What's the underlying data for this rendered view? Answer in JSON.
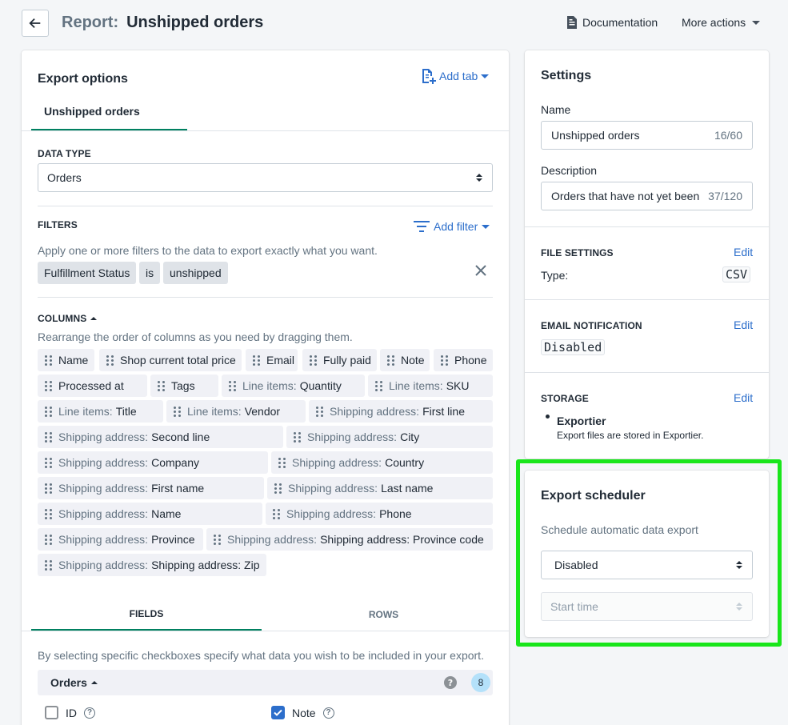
{
  "header": {
    "title_prefix": "Report:",
    "title": "Unshipped orders",
    "documentation_label": "Documentation",
    "more_actions_label": "More actions"
  },
  "export_options": {
    "title": "Export options",
    "add_tab_label": "Add tab",
    "active_tab": "Unshipped orders",
    "data_type": {
      "label": "DATA TYPE",
      "value": "Orders"
    },
    "filters": {
      "label": "FILTERS",
      "add_filter_label": "Add filter",
      "description": "Apply one or more filters to the data to export exactly what you want.",
      "chips": [
        "Fulfillment Status",
        "is",
        "unshipped"
      ]
    },
    "columns": {
      "label": "COLUMNS",
      "description": "Rearrange the order of columns as you need by dragging them.",
      "items": [
        {
          "prefix": "",
          "name": "Name"
        },
        {
          "prefix": "",
          "name": "Shop current total price"
        },
        {
          "prefix": "",
          "name": "Email"
        },
        {
          "prefix": "",
          "name": "Fully paid"
        },
        {
          "prefix": "",
          "name": "Note"
        },
        {
          "prefix": "",
          "name": "Phone"
        },
        {
          "prefix": "",
          "name": "Processed at"
        },
        {
          "prefix": "",
          "name": "Tags"
        },
        {
          "prefix": "Line items:",
          "name": "Quantity"
        },
        {
          "prefix": "Line items:",
          "name": "SKU"
        },
        {
          "prefix": "Line items:",
          "name": "Title"
        },
        {
          "prefix": "Line items:",
          "name": "Vendor"
        },
        {
          "prefix": "Shipping address:",
          "name": "First line"
        },
        {
          "prefix": "Shipping address:",
          "name": "Second line"
        },
        {
          "prefix": "Shipping address:",
          "name": "City"
        },
        {
          "prefix": "Shipping address:",
          "name": "Company"
        },
        {
          "prefix": "Shipping address:",
          "name": "Country"
        },
        {
          "prefix": "Shipping address:",
          "name": "First name"
        },
        {
          "prefix": "Shipping address:",
          "name": "Last name"
        },
        {
          "prefix": "Shipping address:",
          "name": "Name"
        },
        {
          "prefix": "Shipping address:",
          "name": "Phone"
        },
        {
          "prefix": "Shipping address:",
          "name": "Province"
        },
        {
          "prefix": "Shipping address:",
          "name": "Shipping address: Province code"
        },
        {
          "prefix": "Shipping address:",
          "name": "Shipping address: Zip"
        }
      ]
    },
    "bottom_tabs": [
      "FIELDS",
      "ROWS"
    ],
    "fields_description": "By selecting specific checkboxes specify what data you wish to be included in your export.",
    "orders_group": {
      "label": "Orders",
      "count": "8"
    },
    "checkboxes": [
      {
        "label": "ID",
        "checked": false
      },
      {
        "label": "Note",
        "checked": true
      }
    ]
  },
  "settings": {
    "title": "Settings",
    "name": {
      "label": "Name",
      "value": "Unshipped orders",
      "count": "16/60"
    },
    "description": {
      "label": "Description",
      "value": "Orders that have not yet been shipped",
      "count": "37/120"
    },
    "file_settings": {
      "label": "FILE SETTINGS",
      "edit": "Edit",
      "type_label": "Type:",
      "type_value": "CSV"
    },
    "email_notification": {
      "label": "EMAIL NOTIFICATION",
      "edit": "Edit",
      "value": "Disabled"
    },
    "storage": {
      "label": "STORAGE",
      "edit": "Edit",
      "name": "Exportier",
      "note": "Export files are stored in Exportier."
    }
  },
  "scheduler": {
    "title": "Export scheduler",
    "description": "Schedule automatic data export",
    "status": "Disabled",
    "start_time_placeholder": "Start time"
  },
  "colors": {
    "accent": "#2c6ecb",
    "tab_underline": "#008060",
    "highlight": "#19e61b"
  }
}
